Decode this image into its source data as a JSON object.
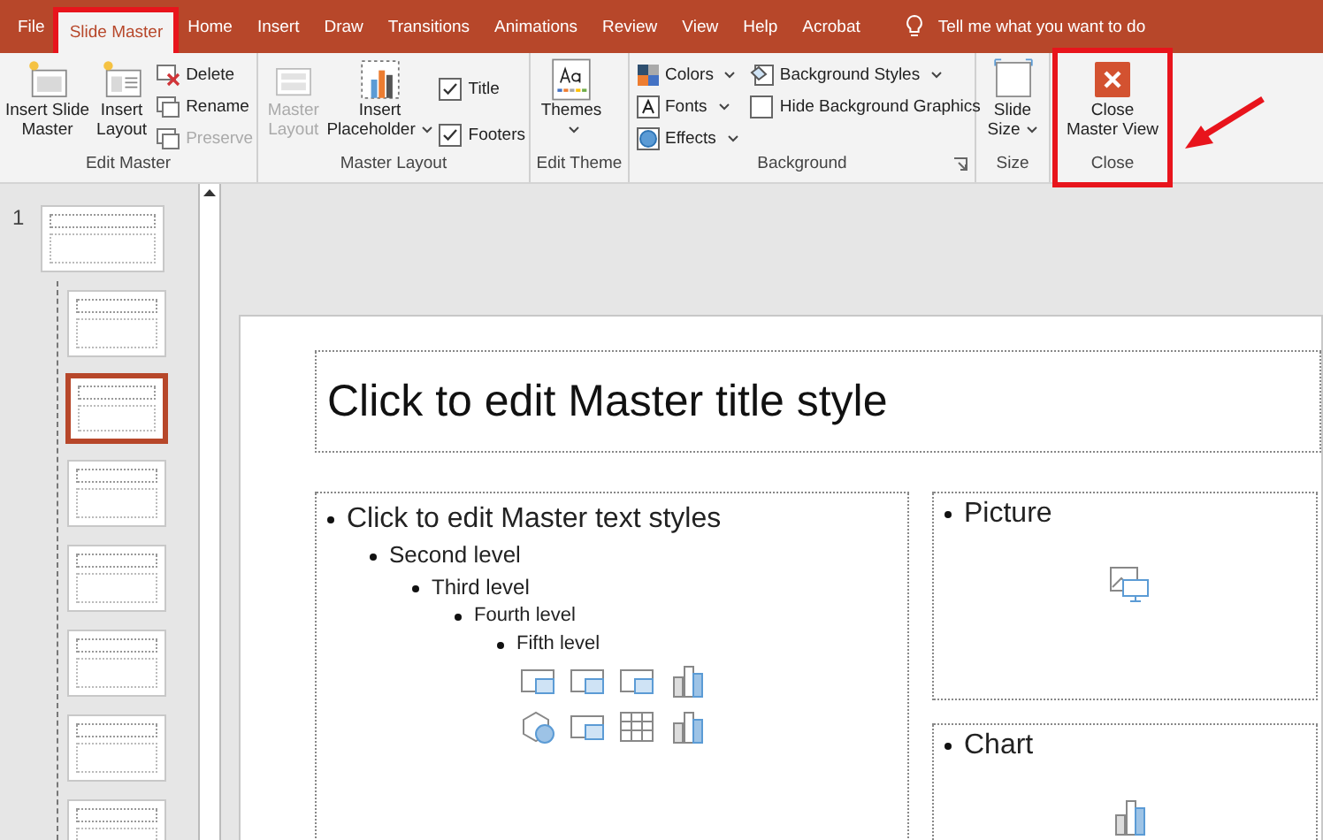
{
  "tabs": [
    {
      "label": "File",
      "selected": false,
      "highlighted": false
    },
    {
      "label": "Slide Master",
      "selected": true,
      "highlighted": true
    },
    {
      "label": "Home",
      "selected": false,
      "highlighted": false
    },
    {
      "label": "Insert",
      "selected": false,
      "highlighted": false
    },
    {
      "label": "Draw",
      "selected": false,
      "highlighted": false
    },
    {
      "label": "Transitions",
      "selected": false,
      "highlighted": false
    },
    {
      "label": "Animations",
      "selected": false,
      "highlighted": false
    },
    {
      "label": "Review",
      "selected": false,
      "highlighted": false
    },
    {
      "label": "View",
      "selected": false,
      "highlighted": false
    },
    {
      "label": "Help",
      "selected": false,
      "highlighted": false
    },
    {
      "label": "Acrobat",
      "selected": false,
      "highlighted": false
    }
  ],
  "tell_me": {
    "placeholder": "Tell me what you want to do"
  },
  "ribbon": {
    "groups": [
      {
        "label": "Edit Master",
        "highlighted": false,
        "items": [
          {
            "label": "Insert Slide\nMaster",
            "disabled": false
          },
          {
            "label": "Insert\nLayout",
            "disabled": false
          },
          {
            "label": "Delete",
            "disabled": false
          },
          {
            "label": "Rename",
            "disabled": false
          },
          {
            "label": "Preserve",
            "disabled": true
          }
        ]
      },
      {
        "label": "Master Layout",
        "highlighted": false,
        "items": [
          {
            "label": "Master\nLayout",
            "disabled": true
          },
          {
            "label": "Insert\nPlaceholder",
            "disabled": false
          },
          {
            "label": "Title",
            "checked": true
          },
          {
            "label": "Footers",
            "checked": true
          }
        ]
      },
      {
        "label": "Edit Theme",
        "highlighted": false,
        "items": [
          {
            "label": "Themes",
            "disabled": false
          }
        ]
      },
      {
        "label": "Background",
        "highlighted": false,
        "items": [
          {
            "label": "Colors",
            "disabled": false
          },
          {
            "label": "Fonts",
            "disabled": false
          },
          {
            "label": "Effects",
            "disabled": false
          },
          {
            "label": "Background Styles",
            "disabled": false
          },
          {
            "label": "Hide Background Graphics",
            "checked": false
          }
        ]
      },
      {
        "label": "Size",
        "highlighted": false,
        "items": [
          {
            "label": "Slide\nSize",
            "disabled": false
          }
        ]
      },
      {
        "label": "Close",
        "highlighted": true,
        "items": [
          {
            "label": "Close\nMaster View",
            "disabled": false
          }
        ]
      }
    ]
  },
  "thumbnails": [
    {
      "kind": "master",
      "number": "1",
      "selected": false
    },
    {
      "kind": "layout",
      "selected": false
    },
    {
      "kind": "layout",
      "selected": true
    },
    {
      "kind": "layout",
      "selected": false
    },
    {
      "kind": "layout",
      "selected": false
    },
    {
      "kind": "layout",
      "selected": false
    },
    {
      "kind": "layout",
      "selected": false
    },
    {
      "kind": "layout",
      "selected": false
    }
  ],
  "slide": {
    "title": "Click to edit Master title style",
    "body": [
      {
        "text": "Click to edit Master text styles",
        "children": [
          {
            "text": "Second level",
            "children": [
              {
                "text": "Third level",
                "children": [
                  {
                    "text": "Fourth level",
                    "children": [
                      {
                        "text": "Fifth level"
                      }
                    ]
                  }
                ]
              }
            ]
          }
        ]
      }
    ],
    "picture_placeholder": "Picture",
    "chart_placeholder": "Chart"
  }
}
